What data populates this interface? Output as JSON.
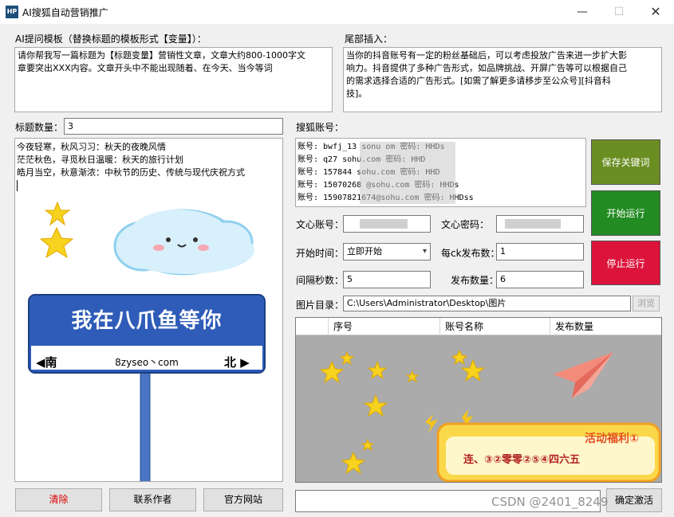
{
  "window": {
    "title": "AI搜狐自动营销推广",
    "icon_text": "HP",
    "min_glyph": "—",
    "max_glyph": "☐",
    "close_glyph": "✕"
  },
  "prompt": {
    "label": "AI提问模板（替换标题的模板形式【变量】）：",
    "text": "请你帮我写一篇标题为【标题变量】营销性文章，文章大约800-1000字文\n章要突出XXX内容。文章开头中不能出现随着、在今天、当今等词"
  },
  "tail": {
    "label": "尾部插入：",
    "text": "当你的抖音账号有一定的粉丝基础后，可以考虑投放广告来进一步扩大影\n响力。抖音提供了多种广告形式，如品牌挑战、开屏广告等可以根据自己\n的需求选择合适的广告形式。[如需了解更多请移步至公众号][抖音科\n技]。"
  },
  "titles": {
    "count_label": "标题数量：",
    "count_value": "3",
    "lines": [
      "今夜轻寒，秋风习习：秋天的夜晚风情",
      "茫茫秋色，寻觅秋日温暖：秋天的旅行计划",
      "皓月当空，秋意渐浓：中秋节的历史、传统与现代庆祝方式"
    ]
  },
  "sohu": {
    "label": "搜狐账号：",
    "accounts": [
      "账号: bwfj_13      sonu   om 密码: HHDs",
      "账号: q27           sohu.com 密码: HHD",
      "账号: 157844       sohu.com 密码: HHD",
      "账号: 15070268     @sohu.com 密码: HHDs",
      "账号: 15907821674@sohu.com 密码: HHDss"
    ]
  },
  "wenxin": {
    "account_label": "文心账号：",
    "account_value": "",
    "password_label": "文心密码：",
    "password_value": ""
  },
  "schedule": {
    "start_label": "开始时间：",
    "start_value": "立即开始",
    "per_label": "每ck发布数：",
    "per_value": "1",
    "interval_label": "间隔秒数：",
    "interval_value": "5",
    "publish_label": "发布数量：",
    "publish_value": "6"
  },
  "image_dir": {
    "label": "图片目录：",
    "value": "C:\\Users\\Administrator\\Desktop\\图片",
    "browse": "浏览"
  },
  "buttons": {
    "save_kw": "保存关键词",
    "start": "开始运行",
    "stop": "停止运行",
    "clear": "清除",
    "contact": "联系作者",
    "website": "官方网站",
    "confirm": "确定激活"
  },
  "table": {
    "columns": [
      "序号",
      "账号名称",
      "发布数量"
    ]
  },
  "ads": {
    "sign_text": "我在八爪鱼等你",
    "sign_left": "◀南",
    "sign_mid": "8zyseo丶com",
    "sign_right": "北 ▶",
    "promo_title": "活动福利①",
    "promo_text": "连、③②零零②⑤④四六五"
  },
  "watermark": "CSDN @2401_8249",
  "status": {
    "value": ""
  }
}
